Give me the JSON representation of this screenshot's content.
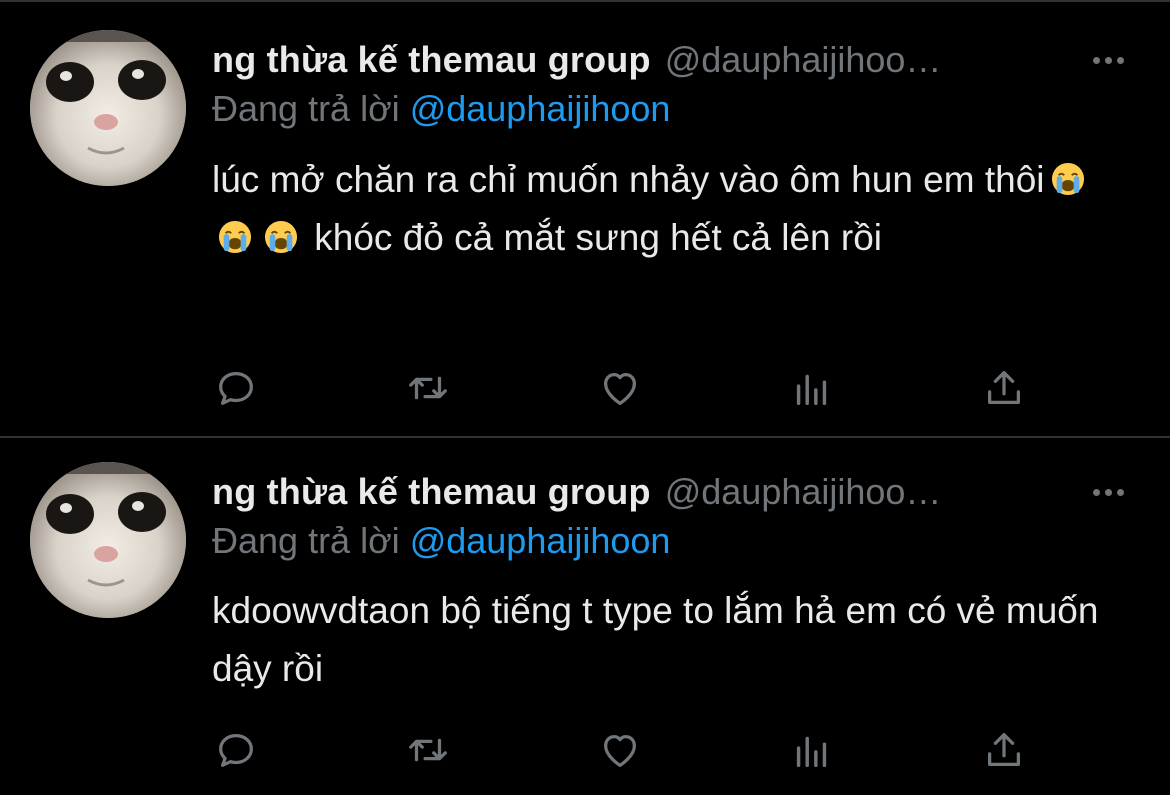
{
  "tweets": [
    {
      "display_name": "ng thừa kế themau group",
      "handle": "@dauphaijihoo…",
      "replying_label": "Đang trả lời",
      "replying_to": "@dauphaijihoon",
      "text_before_emoji": "lúc mở chăn ra chỉ muốn nhảy vào ôm hun em thôi",
      "emoji": [
        "loudly-crying-face",
        "loudly-crying-face",
        "loudly-crying-face"
      ],
      "text_after_emoji": " khóc đỏ cả mắt sưng hết cả lên rồi",
      "actions": [
        "reply-icon",
        "retweet-icon",
        "like-icon",
        "analytics-icon",
        "share-icon"
      ]
    },
    {
      "display_name": "ng thừa kế themau group",
      "handle": "@dauphaijihoo…",
      "replying_label": "Đang trả lời",
      "replying_to": "@dauphaijihoon",
      "text": "kdoowvdtaon bộ tiếng t type to lắm hả em có vẻ muốn dậy rồi",
      "actions": [
        "reply-icon",
        "retweet-icon",
        "like-icon",
        "analytics-icon",
        "share-icon"
      ]
    }
  ],
  "colors": {
    "background": "#000000",
    "primary_text": "#e7e9ea",
    "secondary_text": "#71767b",
    "mention": "#1d9bf0",
    "divider": "#2f3336"
  }
}
